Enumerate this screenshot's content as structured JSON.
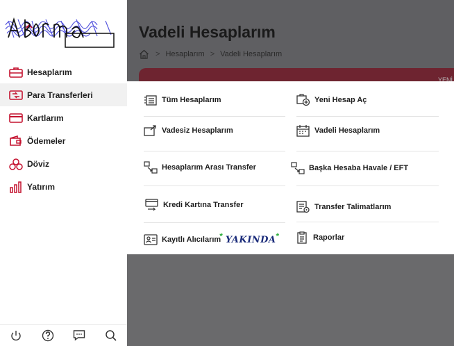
{
  "sidebar": {
    "logo_text": "Adorno",
    "items": [
      {
        "label": "Hesaplarım",
        "icon": "briefcase-icon"
      },
      {
        "label": "Para Transferleri",
        "icon": "transfer-icon"
      },
      {
        "label": "Kartlarım",
        "icon": "card-icon"
      },
      {
        "label": "Ödemeler",
        "icon": "wallet-icon"
      },
      {
        "label": "Döviz",
        "icon": "currency-icon"
      },
      {
        "label": "Yatırım",
        "icon": "bar-chart-icon"
      }
    ],
    "active_item": "Para Transferleri",
    "bottom_icons": [
      "power-icon",
      "help-icon",
      "chat-icon",
      "search-icon"
    ]
  },
  "header": {
    "title": "Vadeli Hesaplarım",
    "breadcrumb": [
      "Hesaplarım",
      "Vadeli Hesaplarım"
    ],
    "banner_text": "YENİ"
  },
  "menu": {
    "left": [
      {
        "label": "Tüm Hesaplarım",
        "icon": "list-icon"
      },
      {
        "label": "Vadesiz Hesaplarım",
        "icon": "wallet-out-icon"
      },
      {
        "label": "Hesaplarım Arası Transfer",
        "icon": "arrows-icon"
      },
      {
        "label": "Kredi Kartına Transfer",
        "icon": "card-transfer-icon"
      },
      {
        "label": "Kayıtlı Alıcılarım",
        "icon": "contacts-icon",
        "note": "YAKINDA",
        "note_mark": "*"
      }
    ],
    "right": [
      {
        "label": "Yeni Hesap Aç",
        "icon": "add-account-icon"
      },
      {
        "label": "Vadeli Hesaplarım",
        "icon": "calendar-icon"
      },
      {
        "label": "Başka Hesaba Havale / EFT",
        "icon": "arrows-icon"
      },
      {
        "label": "Transfer Talimatlarım",
        "icon": "instructions-icon"
      },
      {
        "label": "Raporlar",
        "icon": "report-icon"
      }
    ]
  },
  "colors": {
    "accent": "#c4122f",
    "overlay": "#6a6a6c",
    "banner": "#6e2430",
    "star": "#2fae3e",
    "yakinda": "#1a2b7a"
  }
}
